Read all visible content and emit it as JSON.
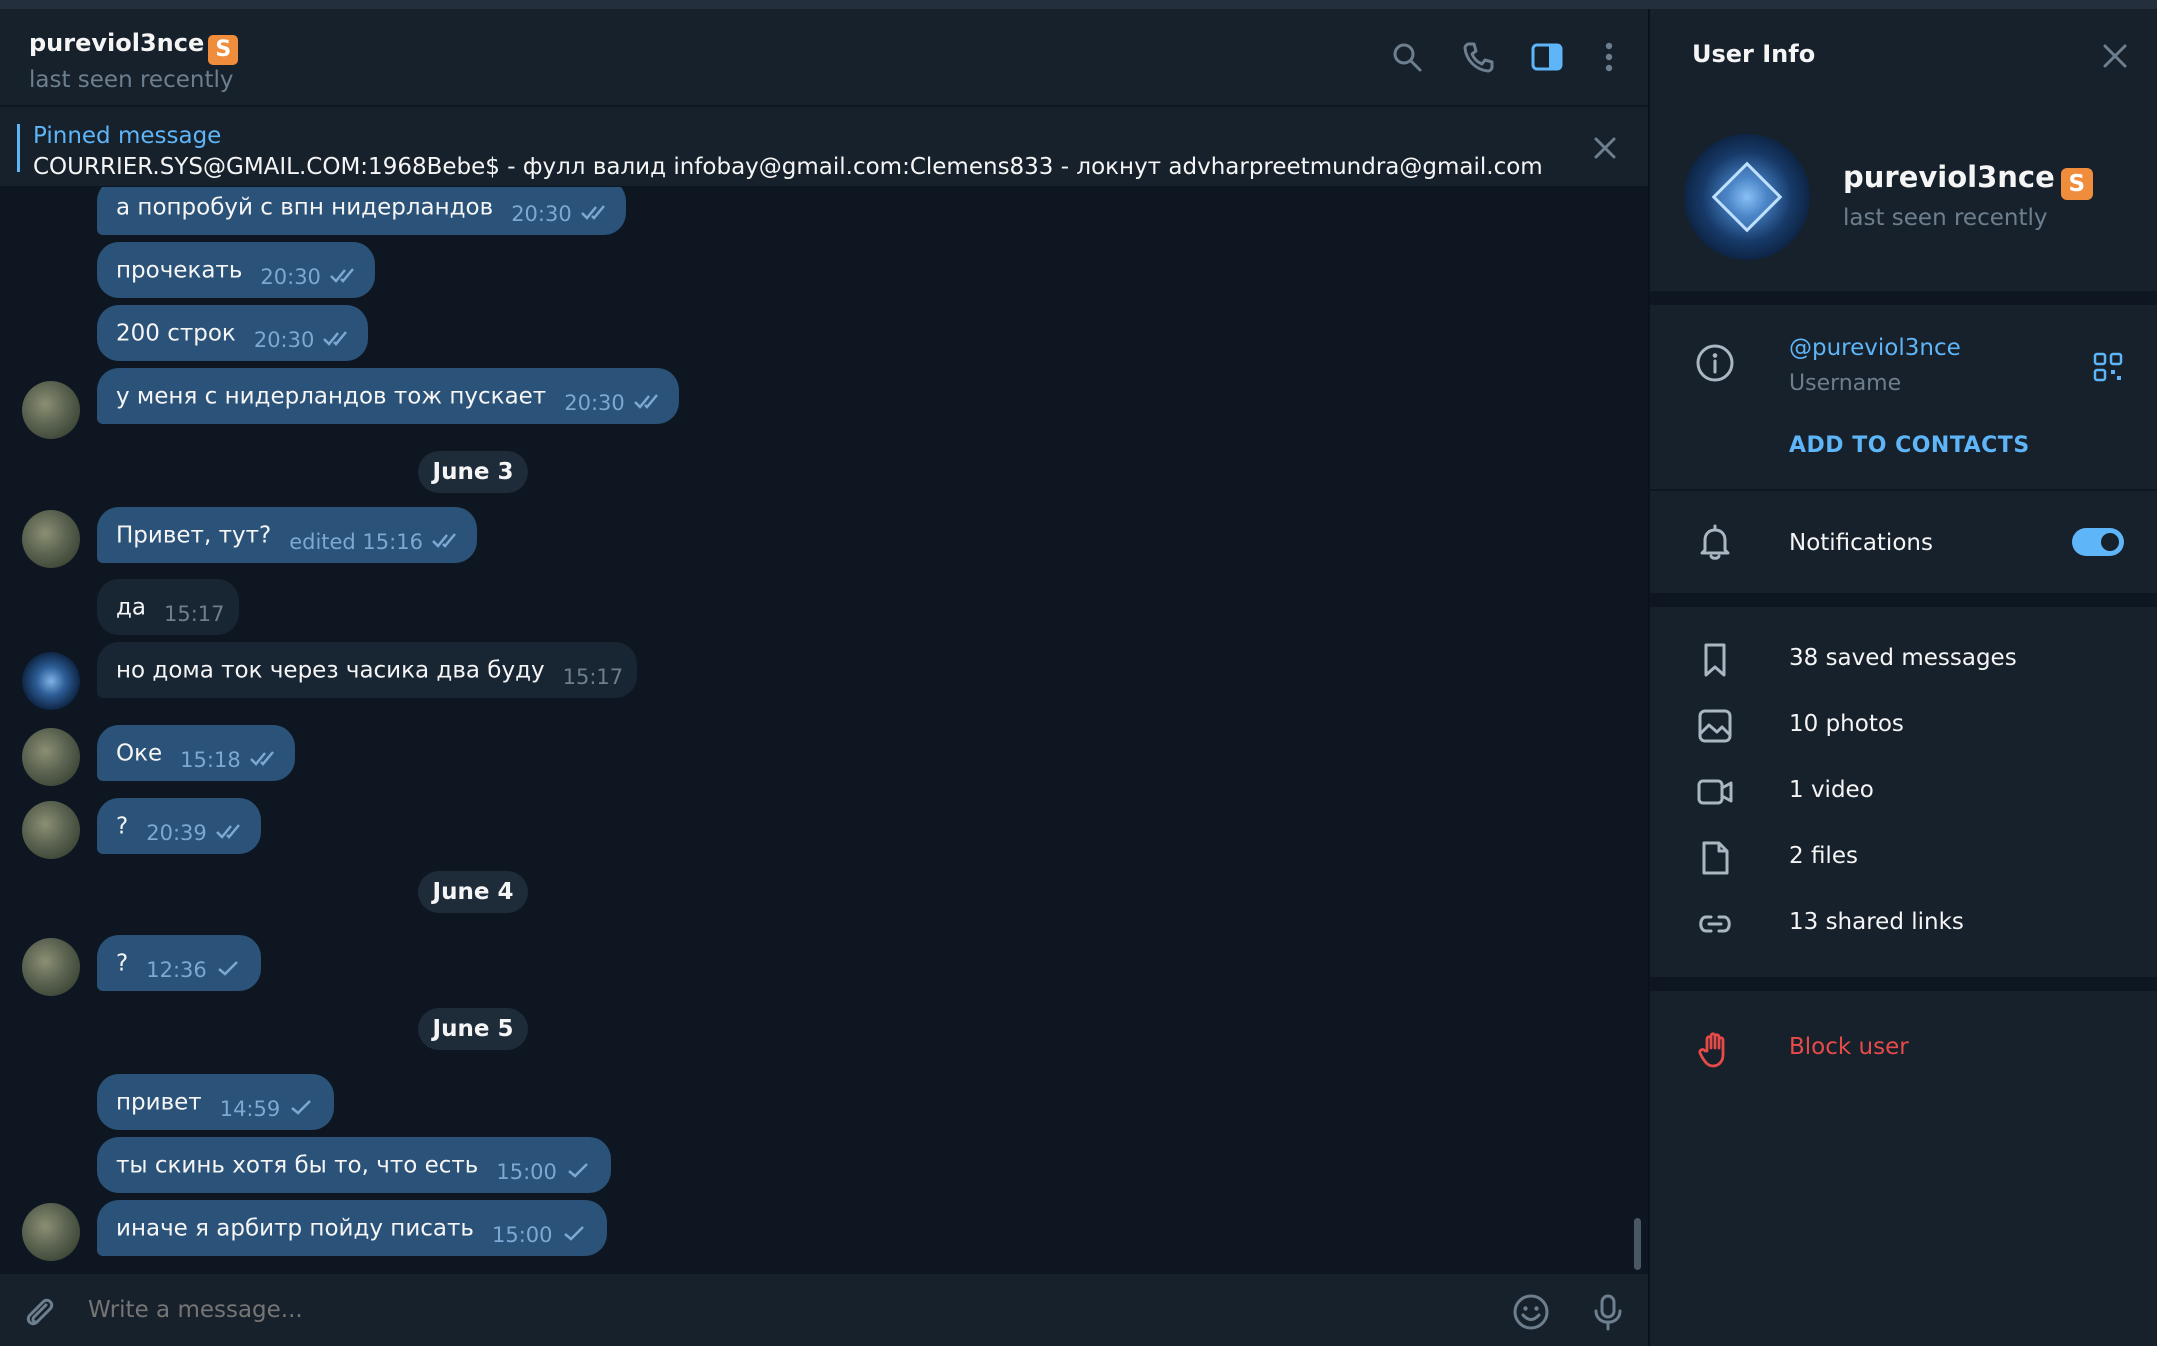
{
  "header": {
    "peer_name": "pureviol3nce",
    "badge": "S",
    "status": "last seen recently"
  },
  "pinned": {
    "title": "Pinned message",
    "text": "COURRIER.SYS@GMAIL.COM:1968Bebe$ - фулл валид infobay@gmail.com:Clemens833 - локнут advharpreetmundra@gmail.com:DeMons..."
  },
  "messages": [
    {
      "text": "а попробуй с впн нидерландов",
      "time": "20:30",
      "dir": "out",
      "ticks": "double"
    },
    {
      "text": "прочекать",
      "time": "20:30",
      "dir": "out",
      "ticks": "double"
    },
    {
      "text": "200 строк",
      "time": "20:30",
      "dir": "out",
      "ticks": "double"
    },
    {
      "text": "у меня с нидерландов тож пускает",
      "time": "20:30",
      "dir": "out",
      "ticks": "double"
    },
    {
      "date": "June 3"
    },
    {
      "text": "Привет, тут?",
      "time": "edited 15:16",
      "dir": "out",
      "ticks": "double"
    },
    {
      "text": "да",
      "time": "15:17",
      "dir": "in"
    },
    {
      "text": "но дома ток через часика два буду",
      "time": "15:17",
      "dir": "in"
    },
    {
      "text": "Оке",
      "time": "15:18",
      "dir": "out",
      "ticks": "double"
    },
    {
      "text": "?",
      "time": "20:39",
      "dir": "out",
      "ticks": "double"
    },
    {
      "date": "June 4"
    },
    {
      "text": "?",
      "time": "12:36",
      "dir": "out",
      "ticks": "single"
    },
    {
      "date": "June 5"
    },
    {
      "text": "привет",
      "time": "14:59",
      "dir": "out",
      "ticks": "single"
    },
    {
      "text": "ты скинь хотя бы то, что есть",
      "time": "15:00",
      "dir": "out",
      "ticks": "single"
    },
    {
      "text": "иначе я арбитр пойду писать",
      "time": "15:00",
      "dir": "out",
      "ticks": "single"
    }
  ],
  "composer": {
    "placeholder": "Write a message..."
  },
  "info": {
    "title": "User Info",
    "name": "pureviol3nce",
    "badge": "S",
    "status": "last seen recently",
    "username": "@pureviol3nce",
    "username_label": "Username",
    "add_contacts": "ADD TO CONTACTS",
    "notifications_label": "Notifications",
    "notifications_on": true,
    "media": {
      "saved": "38 saved messages",
      "photos": "10 photos",
      "video": "1 video",
      "files": "2 files",
      "links": "13 shared links"
    },
    "block": "Block user"
  },
  "colors": {
    "accent": "#5eb5f7",
    "outgoing_bubble": "#2b5278",
    "incoming_bubble": "#182533",
    "danger": "#e84a4a",
    "badge": "#f08d3c"
  },
  "icons": [
    "search-icon",
    "phone-icon",
    "sidebar-toggle-icon",
    "more-icon",
    "close-icon",
    "attach-icon",
    "emoji-icon",
    "mic-icon",
    "info-icon",
    "qr-icon",
    "bell-icon",
    "bookmark-icon",
    "photo-icon",
    "video-icon",
    "file-icon",
    "link-icon",
    "hand-icon"
  ]
}
